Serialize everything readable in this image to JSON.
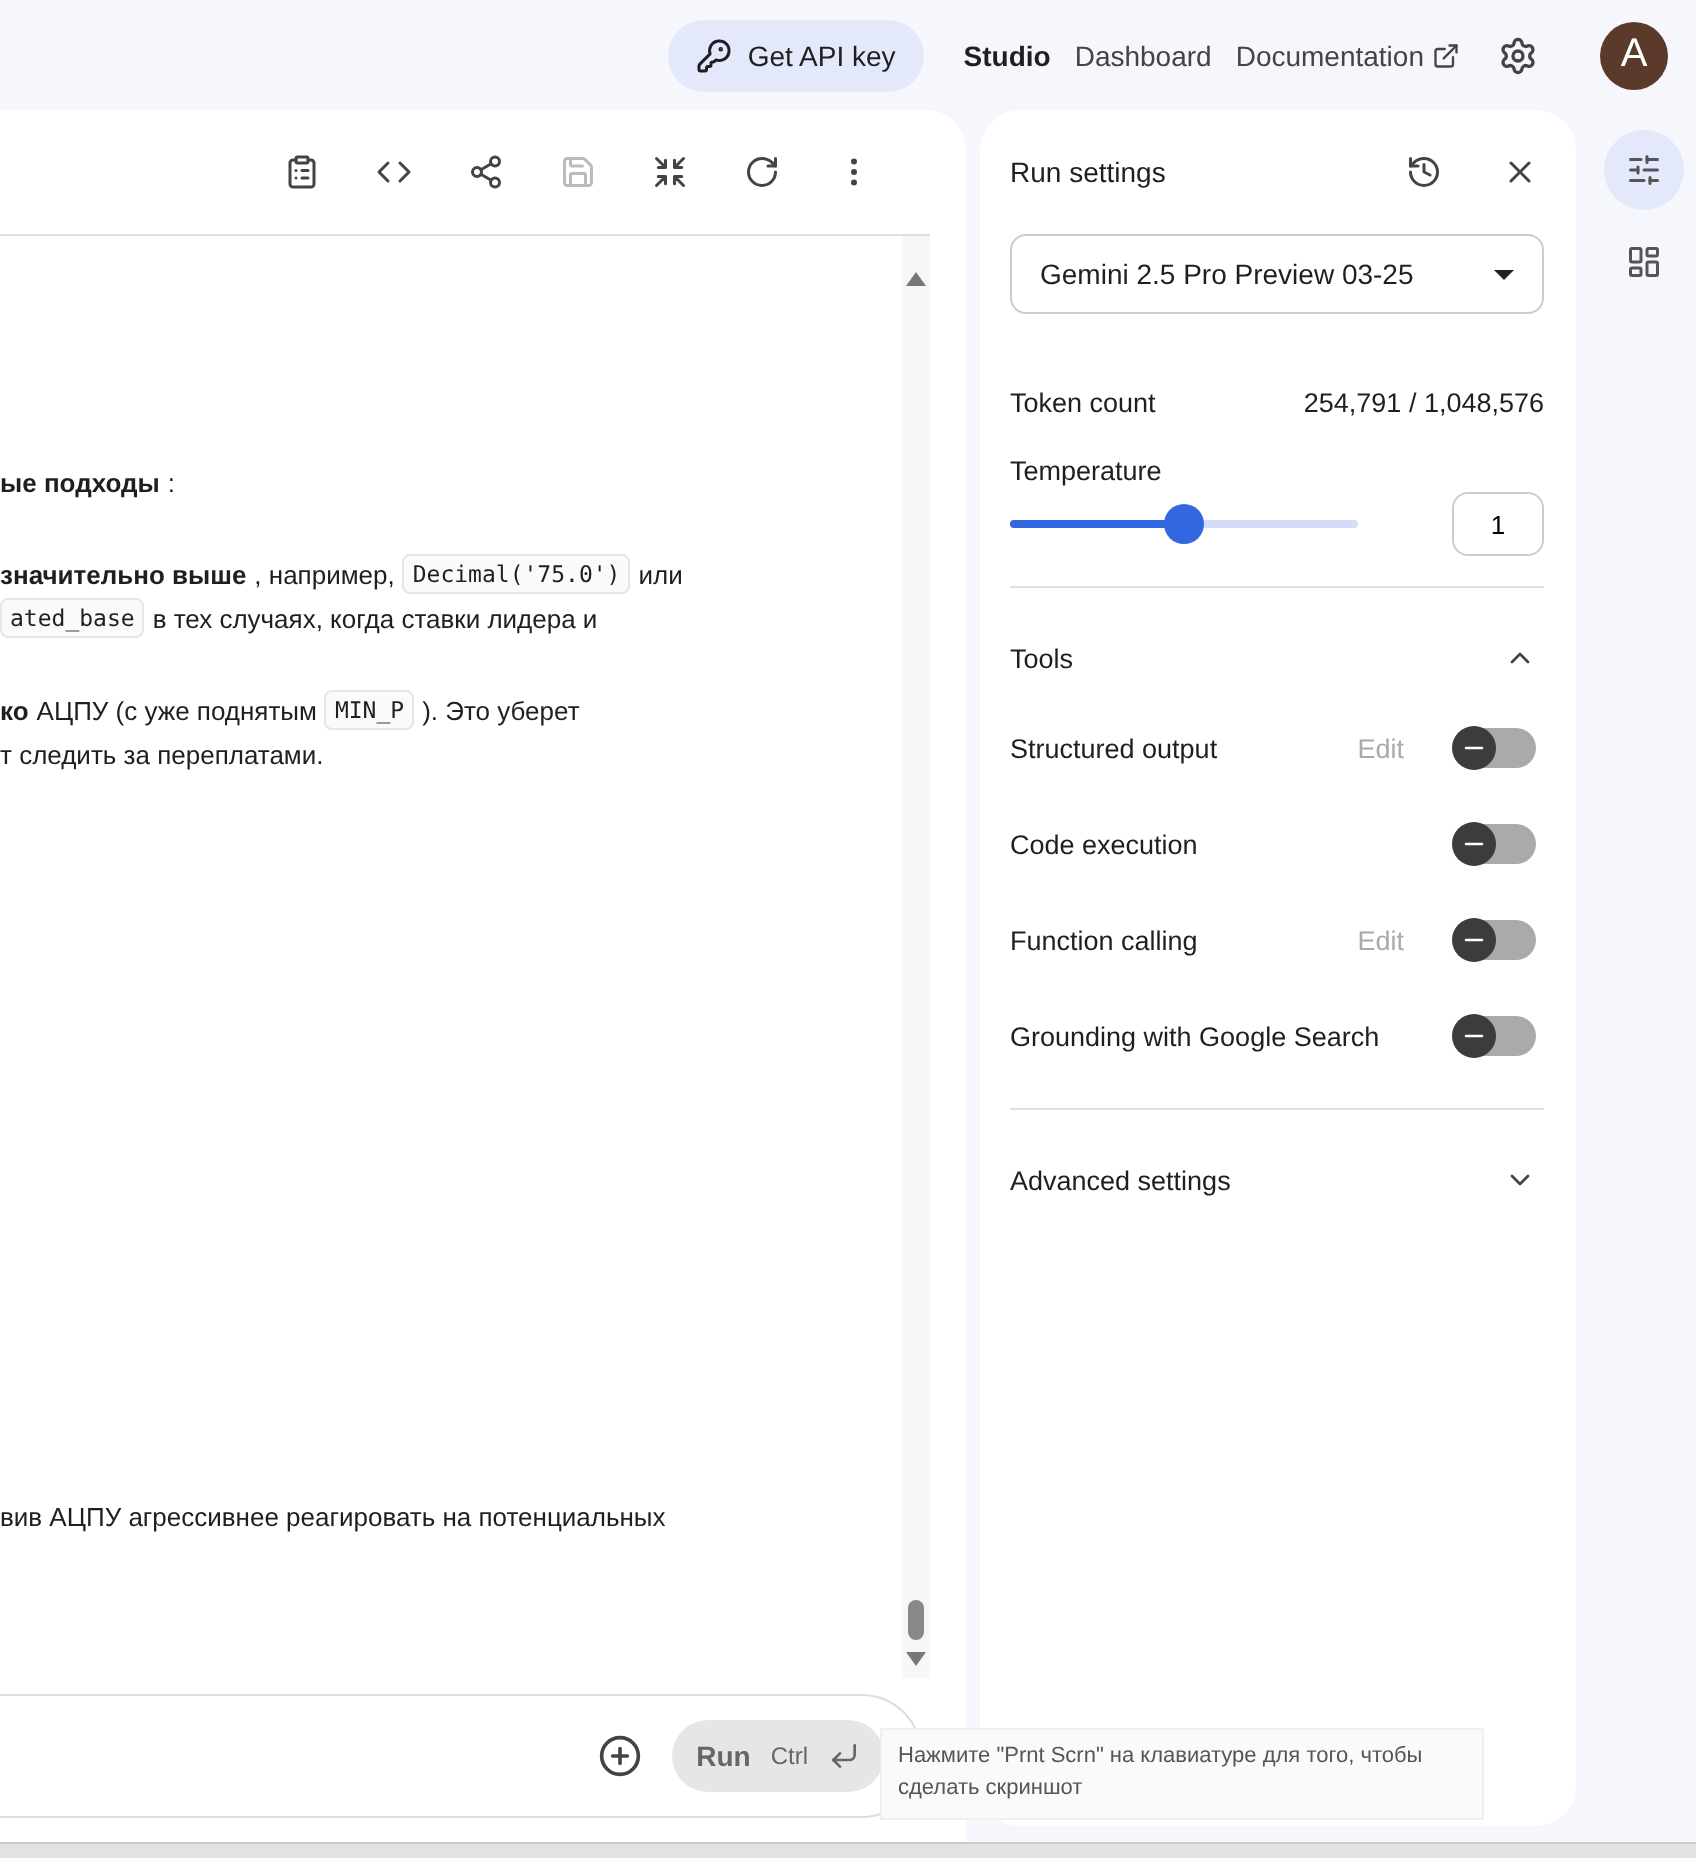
{
  "header": {
    "api_button": "Get API key",
    "nav": [
      {
        "label": "Studio",
        "selected": true,
        "external": false
      },
      {
        "label": "Dashboard",
        "selected": false,
        "external": false
      },
      {
        "label": "Documentation",
        "selected": false,
        "external": true
      }
    ],
    "avatar": "A"
  },
  "chat": {
    "toolbar": [
      {
        "kind": "clipboard",
        "disabled": false
      },
      {
        "kind": "code",
        "disabled": false
      },
      {
        "kind": "share",
        "disabled": false
      },
      {
        "kind": "save",
        "disabled": true
      },
      {
        "kind": "compress",
        "disabled": false
      },
      {
        "kind": "refresh",
        "disabled": false
      },
      {
        "kind": "more",
        "disabled": false
      }
    ],
    "paragraphs": [
      [
        {
          "segments": [
            {
              "kind": "bold",
              "text": "ые подходы"
            },
            {
              "kind": "plain",
              "text": ":"
            }
          ]
        }
      ],
      [
        {
          "segments": [
            {
              "kind": "bold",
              "text": "значительно выше"
            },
            {
              "kind": "plain",
              "text": ", например,"
            },
            {
              "kind": "code",
              "text": "Decimal('75.0')"
            },
            {
              "kind": "plain",
              "text": "или"
            }
          ]
        },
        {
          "segments": [
            {
              "kind": "code",
              "text": "ated_base"
            },
            {
              "kind": "plain",
              "text": "в тех случаях, когда ставки лидера и"
            }
          ]
        }
      ],
      [
        {
          "segments": [
            {
              "kind": "bold",
              "text": "ко"
            },
            {
              "kind": "plain",
              "text": "АЦПУ (с уже поднятым"
            },
            {
              "kind": "code",
              "text": "MIN_P"
            },
            {
              "kind": "plain",
              "text": "). Это уберет"
            }
          ]
        },
        {
          "segments": [
            {
              "kind": "plain",
              "text": "т следить за переплатами."
            }
          ]
        }
      ],
      [
        {
          "segments": [
            {
              "kind": "plain",
              "text": "вив АЦПУ агрессивнее реагировать на потенциальных"
            }
          ]
        }
      ]
    ],
    "run_button": "Run",
    "shortcut": "Ctrl",
    "tooltip": "Нажмите \"Prnt Scrn\" на клавиатуре для того, чтобы сделать скриншот"
  },
  "run_settings": {
    "title": "Run settings",
    "model": "Gemini 2.5 Pro Preview 03-25",
    "token_label": "Token count",
    "token_value": "254,791 / 1,048,576",
    "temperature": {
      "label": "Temperature",
      "level": 0.5,
      "value": "1"
    },
    "tools": {
      "title": "Tools",
      "expanded": true,
      "items": [
        {
          "label": "Structured output",
          "edit": "Edit",
          "on": false
        },
        {
          "label": "Code execution",
          "on": false
        },
        {
          "label": "Function calling",
          "edit": "Edit",
          "on": false
        },
        {
          "label": "Grounding with Google Search",
          "on": false
        }
      ]
    },
    "advanced": {
      "title": "Advanced settings",
      "expanded": false
    }
  },
  "rail": [
    {
      "kind": "tune",
      "selected": true
    },
    {
      "kind": "gallery",
      "selected": false
    }
  ]
}
